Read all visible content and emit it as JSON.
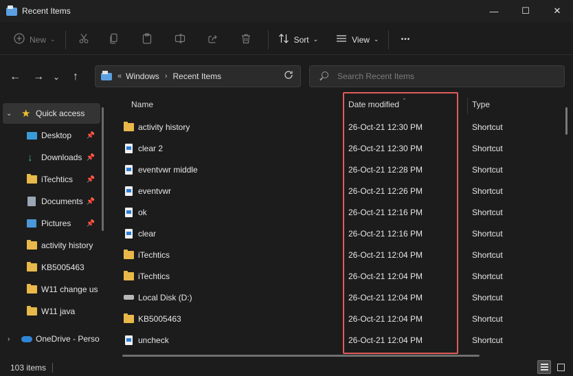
{
  "window": {
    "title": "Recent Items",
    "minimize_glyph": "—",
    "maximize_glyph": "☐",
    "close_glyph": "✕"
  },
  "toolbar": {
    "new_label": "New",
    "sort_label": "Sort",
    "view_label": "View",
    "more_glyph": "•••",
    "icons": [
      "plus-circle-icon",
      "cut-icon",
      "copy-icon",
      "paste-icon",
      "rename-icon",
      "share-icon",
      "delete-icon",
      "sort-icon",
      "view-icon"
    ]
  },
  "address": {
    "overflow": "«",
    "crumbs": [
      "Windows",
      "Recent Items"
    ],
    "separator": "›"
  },
  "search": {
    "placeholder": "Search Recent Items"
  },
  "sidebar": {
    "items": [
      {
        "label": "Quick access",
        "icon": "star-icon",
        "pinned": false
      },
      {
        "label": "Desktop",
        "icon": "desktop-icon",
        "pinned": true
      },
      {
        "label": "Downloads",
        "icon": "downloads-icon",
        "pinned": true
      },
      {
        "label": "iTechtics",
        "icon": "folder-icon",
        "pinned": true
      },
      {
        "label": "Documents",
        "icon": "documents-icon",
        "pinned": true
      },
      {
        "label": "Pictures",
        "icon": "pictures-icon",
        "pinned": true
      },
      {
        "label": "activity history",
        "icon": "folder-icon",
        "pinned": false
      },
      {
        "label": "KB5005463",
        "icon": "folder-icon",
        "pinned": false
      },
      {
        "label": "W11 change us",
        "icon": "folder-icon",
        "pinned": false
      },
      {
        "label": "W11 java",
        "icon": "folder-icon",
        "pinned": false
      },
      {
        "label": "OneDrive - Perso",
        "icon": "onedrive-icon",
        "pinned": false
      }
    ]
  },
  "columns": {
    "name": "Name",
    "date": "Date modified",
    "type": "Type"
  },
  "files": [
    {
      "name": "activity history",
      "date": "26-Oct-21 12:30 PM",
      "type": "Shortcut",
      "icon": "folder"
    },
    {
      "name": "clear 2",
      "date": "26-Oct-21 12:30 PM",
      "type": "Shortcut",
      "icon": "shortcut"
    },
    {
      "name": "eventvwr middle",
      "date": "26-Oct-21 12:28 PM",
      "type": "Shortcut",
      "icon": "shortcut"
    },
    {
      "name": "eventvwr",
      "date": "26-Oct-21 12:26 PM",
      "type": "Shortcut",
      "icon": "shortcut"
    },
    {
      "name": "ok",
      "date": "26-Oct-21 12:16 PM",
      "type": "Shortcut",
      "icon": "shortcut"
    },
    {
      "name": "clear",
      "date": "26-Oct-21 12:16 PM",
      "type": "Shortcut",
      "icon": "shortcut"
    },
    {
      "name": "iTechtics",
      "date": "26-Oct-21 12:04 PM",
      "type": "Shortcut",
      "icon": "folder"
    },
    {
      "name": "iTechtics",
      "date": "26-Oct-21 12:04 PM",
      "type": "Shortcut",
      "icon": "folder"
    },
    {
      "name": "Local Disk (D:)",
      "date": "26-Oct-21 12:04 PM",
      "type": "Shortcut",
      "icon": "disk"
    },
    {
      "name": "KB5005463",
      "date": "26-Oct-21 12:04 PM",
      "type": "Shortcut",
      "icon": "folder"
    },
    {
      "name": "uncheck",
      "date": "26-Oct-21 12:04 PM",
      "type": "Shortcut",
      "icon": "shortcut"
    }
  ],
  "status": {
    "item_count": "103 items"
  },
  "colors": {
    "background": "#1c1c1c",
    "highlight": "#e35b5b",
    "folder": "#e8b84a"
  }
}
